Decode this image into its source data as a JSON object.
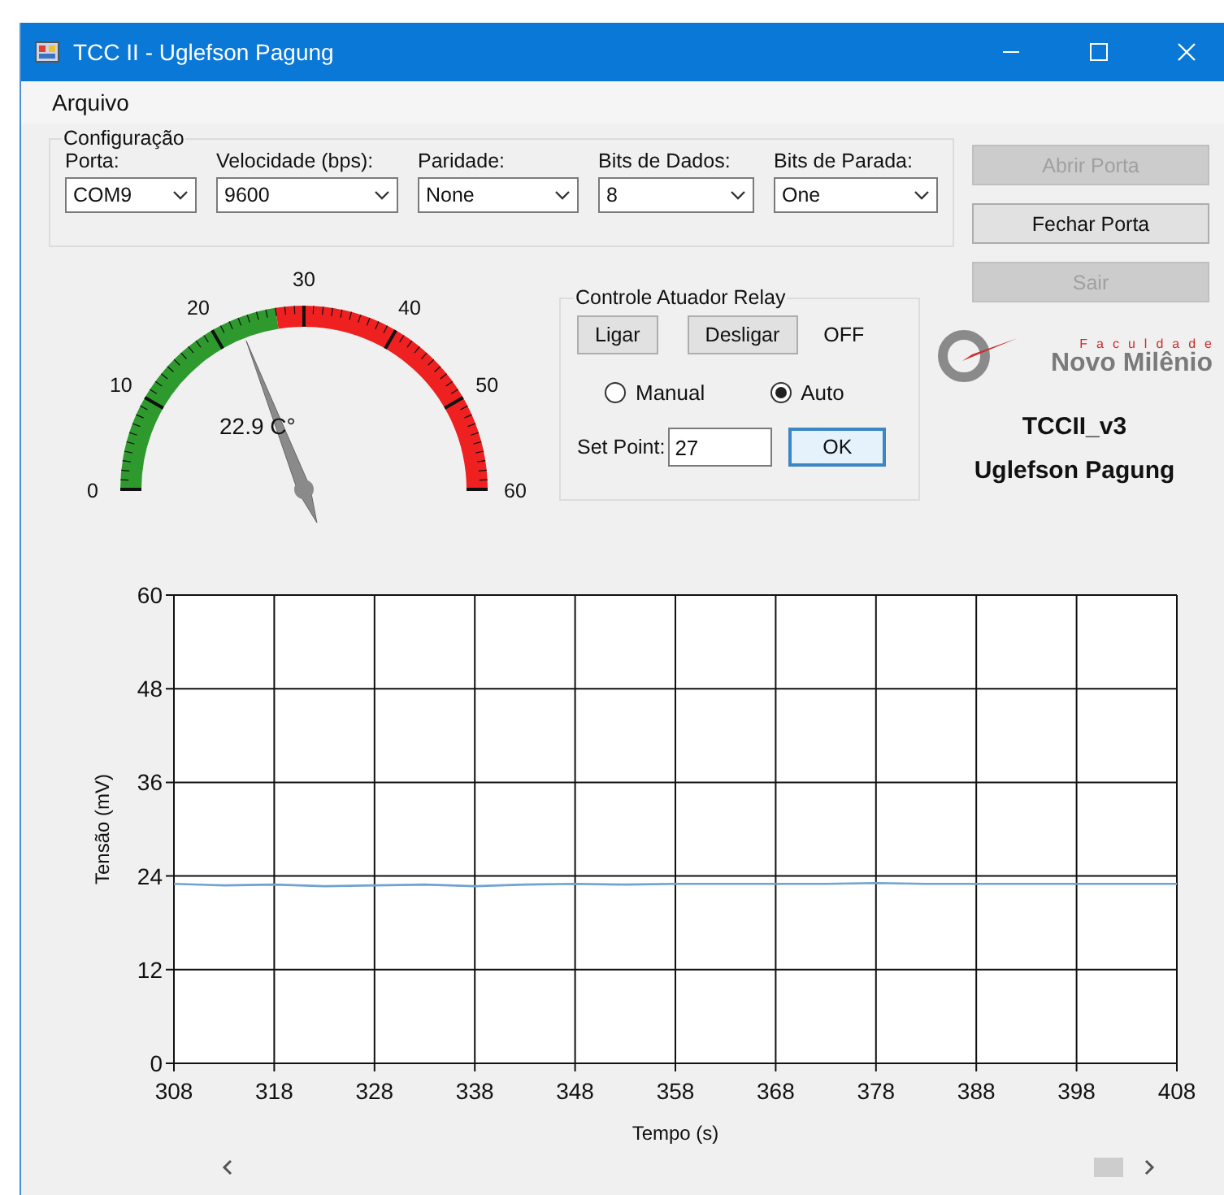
{
  "window": {
    "title": "TCC II - Uglefson Pagung"
  },
  "menu": [
    "Arquivo"
  ],
  "configuration": {
    "title": "Configuração",
    "fields": [
      {
        "label": "Porta:",
        "value": "COM9"
      },
      {
        "label": "Velocidade (bps):",
        "value": "9600"
      },
      {
        "label": "Paridade:",
        "value": "None"
      },
      {
        "label": "Bits de Dados:",
        "value": "8"
      },
      {
        "label": "Bits de Parada:",
        "value": "One"
      }
    ]
  },
  "port_buttons": [
    {
      "label": "Abrir Porta",
      "disabled": true
    },
    {
      "label": "Fechar Porta",
      "disabled": false
    },
    {
      "label": "Sair",
      "disabled": true
    }
  ],
  "gauge": {
    "scale": [
      "0",
      "10",
      "20",
      "30",
      "40",
      "50",
      "60"
    ],
    "reading": "22.9 C°"
  },
  "relay": {
    "title": "Controle Atuador Relay",
    "buttons": [
      "Ligar",
      "Desligar"
    ],
    "status": "OFF",
    "modes": [
      {
        "label": "Manual",
        "selected": false
      },
      {
        "label": "Auto",
        "selected": true
      }
    ],
    "set_point": {
      "label": "Set Point:",
      "value": "27"
    },
    "ok_button": "OK"
  },
  "logo": {
    "tagline": "Faculdade",
    "name": "Novo Milênio"
  },
  "version": "TCCII_v3",
  "author": "Uglefson Pagung",
  "chart": {
    "chart_data": {
      "type": "line",
      "xlabel": "Tempo (s)",
      "ylabel": "Tensão (mV)",
      "x": [
        308,
        313,
        318,
        323,
        328,
        333,
        338,
        343,
        348,
        353,
        358,
        363,
        368,
        373,
        378,
        383,
        388,
        393,
        398,
        403,
        408
      ],
      "series": [
        {
          "color": "#6fa3d0",
          "values": [
            23.0,
            22.8,
            22.9,
            22.7,
            22.8,
            22.9,
            22.7,
            22.9,
            23.0,
            22.9,
            23.0,
            23.0,
            23.0,
            23.0,
            23.1,
            23.0,
            23.0,
            23.0,
            23.0,
            23.0,
            23.0
          ]
        }
      ],
      "xlim": [
        308,
        408
      ],
      "ylim": [
        0,
        60
      ],
      "grid": true,
      "xticks": [
        308,
        318,
        328,
        338,
        348,
        358,
        368,
        378,
        388,
        398,
        408
      ],
      "yticks": [
        0,
        12,
        24,
        36,
        48,
        60
      ]
    }
  }
}
